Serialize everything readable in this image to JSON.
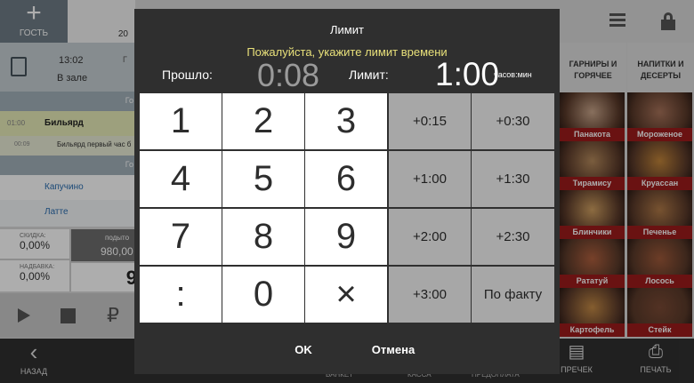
{
  "app": {
    "guest_label": "ГОСТЬ",
    "guest_plus": "+",
    "table_number": "20",
    "order_time": "13:02",
    "order_place": "В зале",
    "order_tiny": "Г",
    "group_row_1": "Го",
    "group_row_2": "Го",
    "billiard_time": "01:00",
    "billiard_name": "Бильярд",
    "billiard2_time": "00:09",
    "billiard2_name": "Бильярд первый час б",
    "item_cappuccino": "Капучино",
    "item_latte": "Латте",
    "discount_label": "СКИДКА:",
    "discount_value": "0,00%",
    "markup_label": "НАДБАВКА:",
    "markup_value": "0,00%",
    "subtotal_label": "подыто",
    "subtotal_value": "980,00",
    "total_partial": "9",
    "ruble_icon": "₽",
    "back_label": "НАЗАД",
    "back_icon": "‹",
    "bottom_items": [
      "БАНКЕТ",
      "КАССА",
      "ПРЕДОПЛАТА"
    ],
    "precheck_label": "ПРЕЧЕК",
    "print_label": "ПЕЧАТЬ"
  },
  "categories": [
    "ГАРНИРЫ И ГОРЯЧЕЕ",
    "НАПИТКИ И ДЕСЕРТЫ"
  ],
  "tiles": [
    {
      "name": "Панакота",
      "color": "#c9a58a"
    },
    {
      "name": "Мороженое",
      "color": "#a8735a"
    },
    {
      "name": "Тирамису",
      "color": "#b58a5c"
    },
    {
      "name": "Круассан",
      "color": "#c2853a"
    },
    {
      "name": "Блинчики",
      "color": "#d0a061"
    },
    {
      "name": "Печенье",
      "color": "#b07a48"
    },
    {
      "name": "Рататуй",
      "color": "#b0603e"
    },
    {
      "name": "Лосось",
      "color": "#a05a3a"
    },
    {
      "name": "Картофель",
      "color": "#c48a46"
    },
    {
      "name": "Стейк",
      "color": "#7a4a35"
    }
  ],
  "modal": {
    "title": "Лимит",
    "subtitle": "Пожалуйста, укажите лимит времени",
    "elapsed_label": "Прошло:",
    "elapsed_value": "0:08",
    "limit_label": "Лимит:",
    "limit_value": "1:00",
    "limit_unit": "часов:мин",
    "keys": [
      "1",
      "2",
      "3",
      "+0:15",
      "+0:30",
      "4",
      "5",
      "6",
      "+1:00",
      "+1:30",
      "7",
      "8",
      "9",
      "+2:00",
      "+2:30",
      ":",
      "0",
      "×",
      "+3:00",
      "По факту"
    ],
    "ok_label": "OK",
    "cancel_label": "Отмена"
  }
}
